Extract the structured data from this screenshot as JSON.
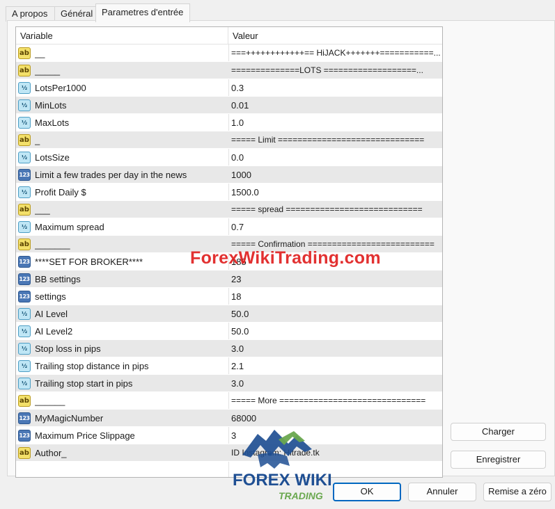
{
  "tabs": [
    {
      "label": "A propos",
      "active": false
    },
    {
      "label": "Général",
      "active": false
    },
    {
      "label": "Parametres d'entrée",
      "active": true
    }
  ],
  "grid": {
    "columns": {
      "variable": "Variable",
      "value": "Valeur"
    },
    "rows": [
      {
        "type": "ab",
        "name": "__",
        "value": "===++++++++++++== HiJACK+++++++===========..."
      },
      {
        "type": "ab",
        "name": "_____",
        "value": "==============LOTS ===================..."
      },
      {
        "type": "half",
        "name": "LotsPer1000",
        "value": "0.3"
      },
      {
        "type": "half",
        "name": "MinLots",
        "value": "0.01"
      },
      {
        "type": "half",
        "name": "MaxLots",
        "value": "1.0"
      },
      {
        "type": "ab",
        "name": "_",
        "value": "===== Limit =============================="
      },
      {
        "type": "half",
        "name": "LotsSize",
        "value": "0.0"
      },
      {
        "type": "int",
        "name": "Limit a few trades per day in the news",
        "value": "1000"
      },
      {
        "type": "half",
        "name": "Profit Daily $",
        "value": "1500.0"
      },
      {
        "type": "ab",
        "name": "___",
        "value": "===== spread ============================"
      },
      {
        "type": "half",
        "name": "Maximum spread",
        "value": "0.7"
      },
      {
        "type": "ab",
        "name": "_______",
        "value": "===== Confirmation =========================="
      },
      {
        "type": "int",
        "name": "****SET FOR BROKER****",
        "value": "185"
      },
      {
        "type": "int",
        "name": "BB settings",
        "value": "23"
      },
      {
        "type": "int",
        "name": "settings",
        "value": "18"
      },
      {
        "type": "half",
        "name": "AI Level",
        "value": "50.0"
      },
      {
        "type": "half",
        "name": "AI Level2",
        "value": "50.0"
      },
      {
        "type": "half",
        "name": "Stop loss in pips",
        "value": "3.0"
      },
      {
        "type": "half",
        "name": "Trailing stop distance in pips",
        "value": "2.1"
      },
      {
        "type": "half",
        "name": "Trailing stop start in pips",
        "value": "3.0"
      },
      {
        "type": "ab",
        "name": "______",
        "value": "===== More =============================="
      },
      {
        "type": "int",
        "name": "MyMagicNumber",
        "value": "68000"
      },
      {
        "type": "int",
        "name": "Maximum Price Slippage",
        "value": "3"
      },
      {
        "type": "ab",
        "name": "Author_",
        "value": "ID Instagram: Hitrade.tk"
      }
    ]
  },
  "type_icons": {
    "ab": "ab",
    "half": "½",
    "int": "123"
  },
  "buttons": {
    "load": "Charger",
    "save": "Enregistrer",
    "ok": "OK",
    "cancel": "Annuler",
    "reset": "Remise a zéro"
  },
  "watermark": {
    "text": "ForexWikiTrading.com",
    "logo_top": "FOREX WIKI",
    "logo_bottom": "TRADING"
  },
  "colors": {
    "accent": "#0067c0",
    "watermark_red": "#e02020",
    "logo_blue": "#1f4f93",
    "logo_green": "#6aa84f"
  }
}
